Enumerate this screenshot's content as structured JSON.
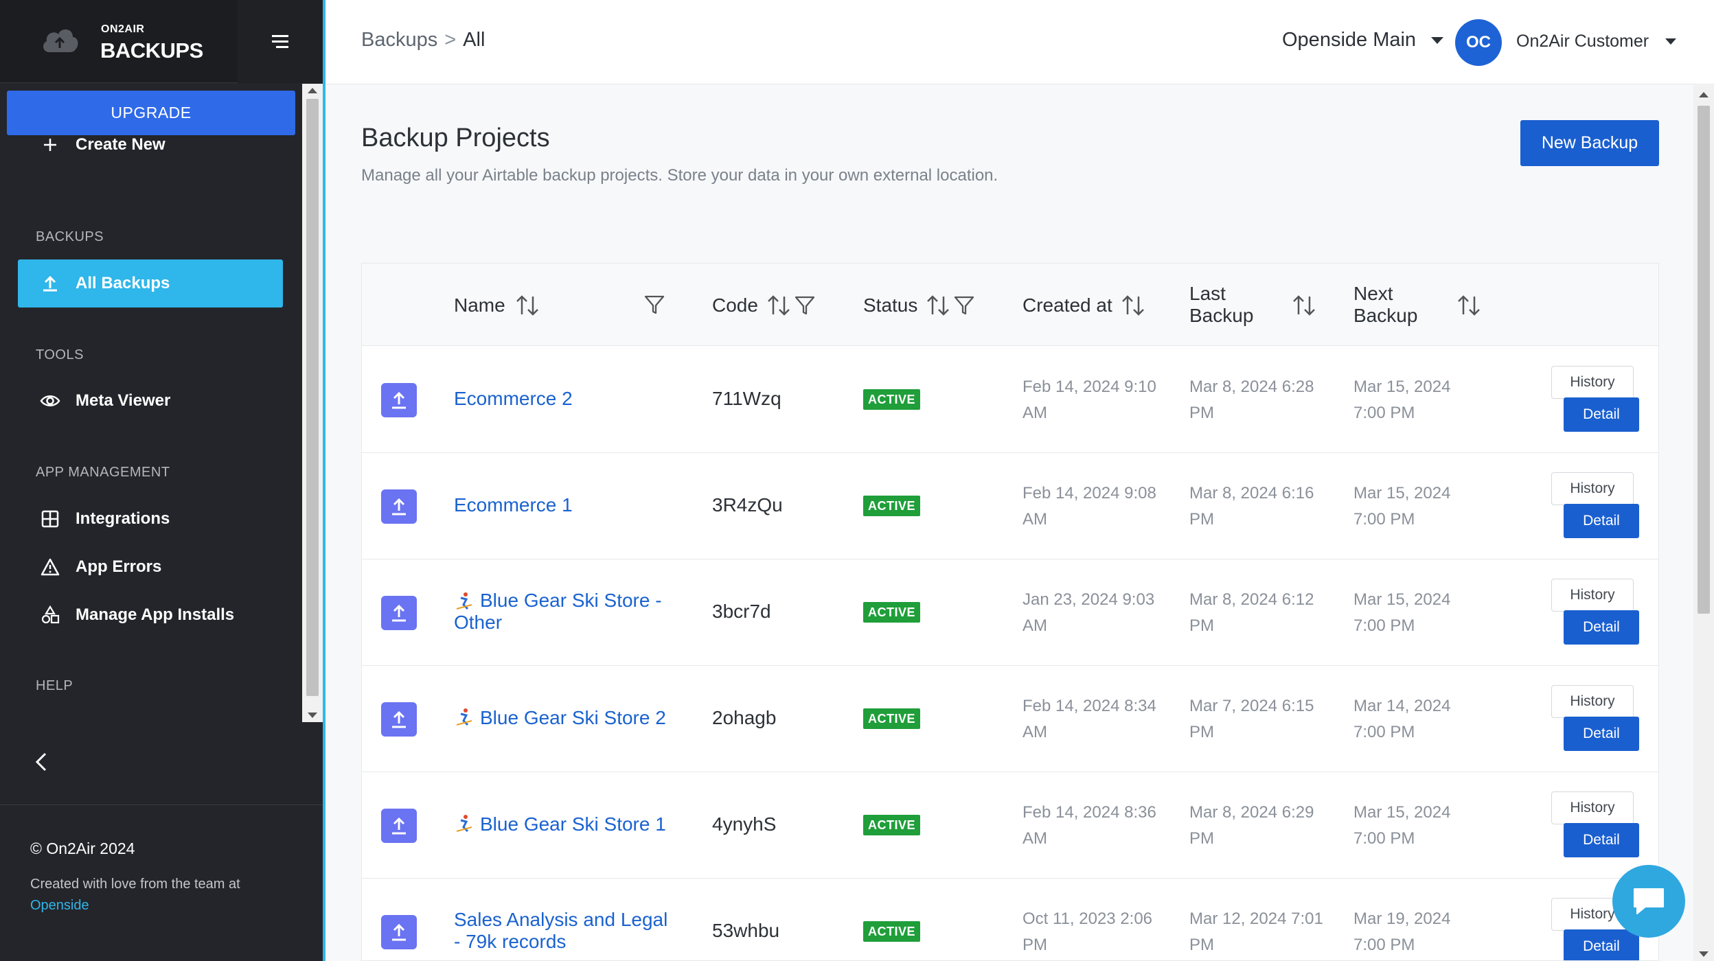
{
  "brand": {
    "small": "ON2AIR",
    "big": "BACKUPS"
  },
  "sidebar": {
    "upgrade": "UPGRADE",
    "create_new": "Create New",
    "sections": {
      "backups": "BACKUPS",
      "tools": "TOOLS",
      "app_management": "APP MANAGEMENT",
      "help": "HELP"
    },
    "items": {
      "all_backups": "All Backups",
      "meta_viewer": "Meta Viewer",
      "integrations": "Integrations",
      "app_errors": "App Errors",
      "manage_app_installs": "Manage App Installs"
    },
    "footer": {
      "copyright": "© On2Air 2024",
      "credit": "Created with love from the team at",
      "credit_link": "Openside"
    }
  },
  "header": {
    "breadcrumb": {
      "root": "Backups",
      "separator": ">",
      "current": "All"
    },
    "workspace": "Openside Main",
    "avatar": "OC",
    "user": "On2Air Customer"
  },
  "main": {
    "title": "Backup Projects",
    "subtitle": "Manage all your Airtable backup projects. Store your data in your own external location.",
    "new_backup": "New Backup"
  },
  "table": {
    "columns": {
      "name": "Name",
      "code": "Code",
      "status": "Status",
      "created": "Created at",
      "last": "Last Backup",
      "next": "Next Backup"
    },
    "rows": [
      {
        "name": "Ecommerce 2",
        "code": "711Wzq",
        "status": "ACTIVE",
        "created": "Feb 14, 2024 9:10 AM",
        "last": "Mar 8, 2024 6:28 PM",
        "next": "Mar 15, 2024 7:00 PM",
        "history": "History",
        "detail": "Detail"
      },
      {
        "name": "Ecommerce 1",
        "code": "3R4zQu",
        "status": "ACTIVE",
        "created": "Feb 14, 2024 9:08 AM",
        "last": "Mar 8, 2024 6:16 PM",
        "next": "Mar 15, 2024 7:00 PM",
        "history": "History",
        "detail": "Detail"
      },
      {
        "name": "Blue Gear Ski Store - Other",
        "code": "3bcr7d",
        "status": "ACTIVE",
        "created": "Jan 23, 2024 9:03 AM",
        "last": "Mar 8, 2024 6:12 PM",
        "next": "Mar 15, 2024 7:00 PM",
        "history": "History",
        "detail": "Detail"
      },
      {
        "name": "Blue Gear Ski Store 2",
        "code": "2ohagb",
        "status": "ACTIVE",
        "created": "Feb 14, 2024 8:34 AM",
        "last": "Mar 7, 2024 6:15 PM",
        "next": "Mar 14, 2024 7:00 PM",
        "history": "History",
        "detail": "Detail"
      },
      {
        "name": "Blue Gear Ski Store 1",
        "code": "4ynyhS",
        "status": "ACTIVE",
        "created": "Feb 14, 2024 8:36 AM",
        "last": "Mar 8, 2024 6:29 PM",
        "next": "Mar 15, 2024 7:00 PM",
        "history": "History",
        "detail": "Detail"
      },
      {
        "name": "Sales Analysis and Legal - 79k records",
        "code": "53whbu",
        "status": "ACTIVE",
        "created": "Oct 11, 2023 2:06 PM",
        "last": "Mar 12, 2024 7:01 PM",
        "next": "Mar 19, 2024 7:00 PM",
        "history": "History",
        "detail": "Detail"
      }
    ]
  },
  "colors": {
    "accent": "#2fb6ea",
    "primary": "#1a5fcf",
    "active": "#1f9e3a",
    "sidebar": "#24252a"
  }
}
